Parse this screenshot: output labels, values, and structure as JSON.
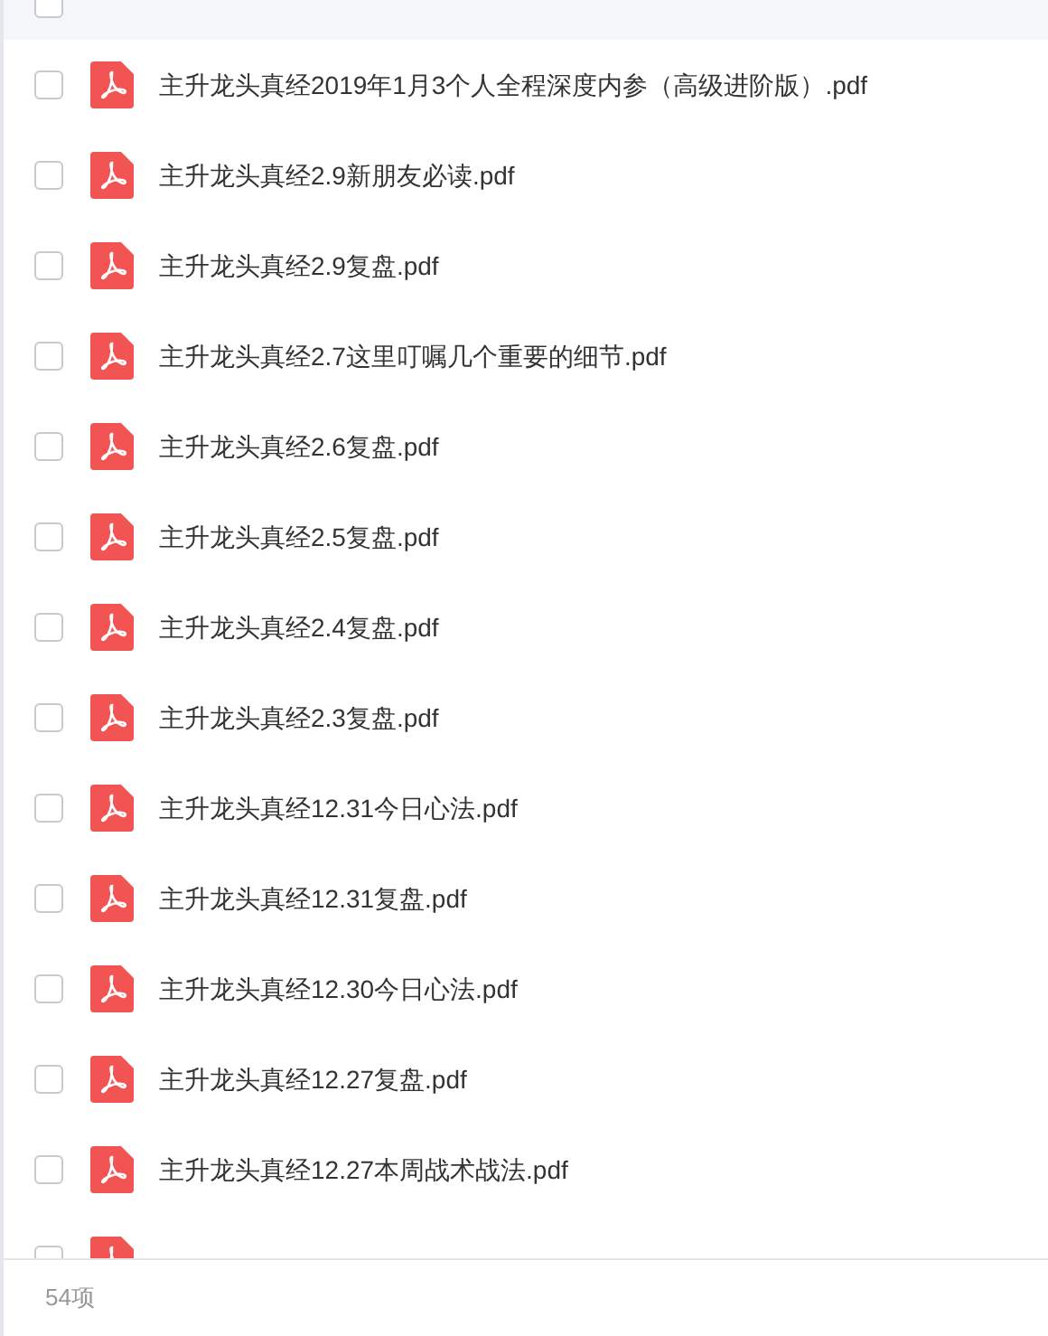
{
  "header": {
    "checked": false
  },
  "files": [
    {
      "name": "主升龙头真经2019年1月3个人全程深度内参（高级进阶版）.pdf",
      "checked": false
    },
    {
      "name": "主升龙头真经2.9新朋友必读.pdf",
      "checked": false
    },
    {
      "name": "主升龙头真经2.9复盘.pdf",
      "checked": false
    },
    {
      "name": "主升龙头真经2.7这里叮嘱几个重要的细节.pdf",
      "checked": false
    },
    {
      "name": "主升龙头真经2.6复盘.pdf",
      "checked": false
    },
    {
      "name": "主升龙头真经2.5复盘.pdf",
      "checked": false
    },
    {
      "name": "主升龙头真经2.4复盘.pdf",
      "checked": false
    },
    {
      "name": "主升龙头真经2.3复盘.pdf",
      "checked": false
    },
    {
      "name": "主升龙头真经12.31今日心法.pdf",
      "checked": false
    },
    {
      "name": "主升龙头真经12.31复盘.pdf",
      "checked": false
    },
    {
      "name": "主升龙头真经12.30今日心法.pdf",
      "checked": false
    },
    {
      "name": "主升龙头真经12.27复盘.pdf",
      "checked": false
    },
    {
      "name": "主升龙头真经12.27本周战术战法.pdf",
      "checked": false
    },
    {
      "checked": false
    }
  ],
  "footer": {
    "count": "54项"
  }
}
